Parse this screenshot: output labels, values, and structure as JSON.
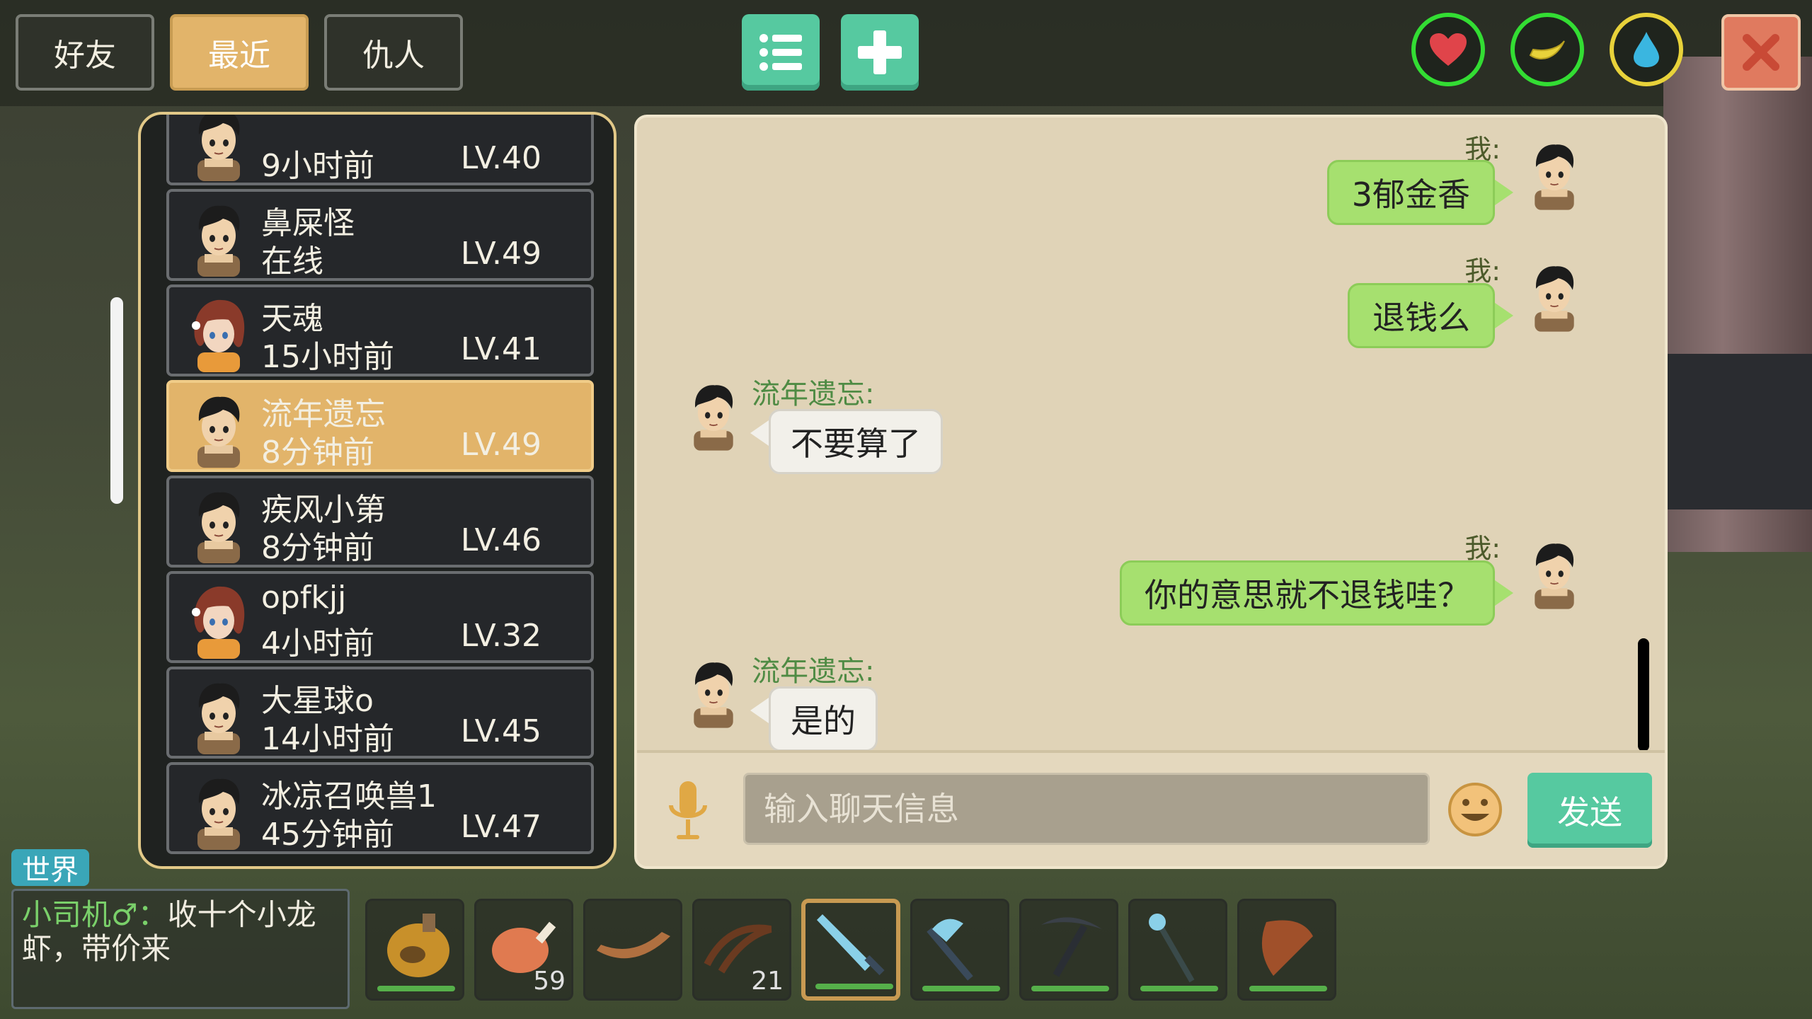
{
  "tabs": [
    {
      "label": "好友",
      "active": false
    },
    {
      "label": "最近",
      "active": true
    },
    {
      "label": "仇人",
      "active": false
    }
  ],
  "toolbar": {
    "list_icon": "list-icon",
    "add_icon": "plus-icon",
    "close_icon": "close-icon"
  },
  "status": [
    {
      "icon": "heart-icon",
      "color": "#e0444a",
      "ring": "#33dd33"
    },
    {
      "icon": "banana-icon",
      "color": "#e8d23a",
      "ring": "#33dd33"
    },
    {
      "icon": "water-drop-icon",
      "color": "#3ab6e0",
      "ring": "#e8d23a"
    }
  ],
  "friends": [
    {
      "name": "",
      "status": "9小时前",
      "level": "LV.40",
      "avatar": "boy",
      "selected": false
    },
    {
      "name": "鼻屎怪",
      "status": "在线",
      "level": "LV.49",
      "avatar": "boy",
      "selected": false
    },
    {
      "name": "天魂",
      "status": "15小时前",
      "level": "LV.41",
      "avatar": "girl",
      "selected": false
    },
    {
      "name": "流年遗忘",
      "status": "8分钟前",
      "level": "LV.49",
      "avatar": "boy",
      "selected": true
    },
    {
      "name": "疾风小第",
      "status": "8分钟前",
      "level": "LV.46",
      "avatar": "boy",
      "selected": false
    },
    {
      "name": "opfkjj",
      "status": "4小时前",
      "level": "LV.32",
      "avatar": "girl",
      "selected": false
    },
    {
      "name": "大星球o",
      "status": "14小时前",
      "level": "LV.45",
      "avatar": "boy",
      "selected": false
    },
    {
      "name": "冰凉召唤兽1",
      "status": "45分钟前",
      "level": "LV.47",
      "avatar": "boy",
      "selected": false
    }
  ],
  "chat": {
    "me_label": "我:",
    "other_label": "流年遗忘:",
    "messages": [
      {
        "from": "me",
        "text": "3郁金香"
      },
      {
        "from": "me",
        "text": "退钱么"
      },
      {
        "from": "other",
        "text": "不要算了"
      },
      {
        "from": "me",
        "text": "你的意思就不退钱哇？"
      },
      {
        "from": "other",
        "text": "是的"
      }
    ],
    "input_placeholder": "输入聊天信息",
    "send_label": "发送",
    "mic_icon": "microphone-icon",
    "emoji_icon": "smiley-icon"
  },
  "world": {
    "tag": "世界",
    "sender": "小司机♂",
    "sep": "：",
    "message": "收十个小龙虾，带价来"
  },
  "hotbar": [
    {
      "item": "gourd-flask-icon",
      "count": "",
      "durability": true
    },
    {
      "item": "meat-drumstick-icon",
      "count": "59",
      "durability": false
    },
    {
      "item": "wooden-boat-icon",
      "count": "",
      "durability": false
    },
    {
      "item": "rope-whip-icon",
      "count": "21",
      "durability": false
    },
    {
      "item": "crystal-sword-icon",
      "count": "",
      "durability": true,
      "selected": true
    },
    {
      "item": "crystal-axe-icon",
      "count": "",
      "durability": true
    },
    {
      "item": "pickaxe-icon",
      "count": "",
      "durability": true
    },
    {
      "item": "crystal-wand-icon",
      "count": "",
      "durability": true
    },
    {
      "item": "horn-club-icon",
      "count": "",
      "durability": true
    }
  ]
}
